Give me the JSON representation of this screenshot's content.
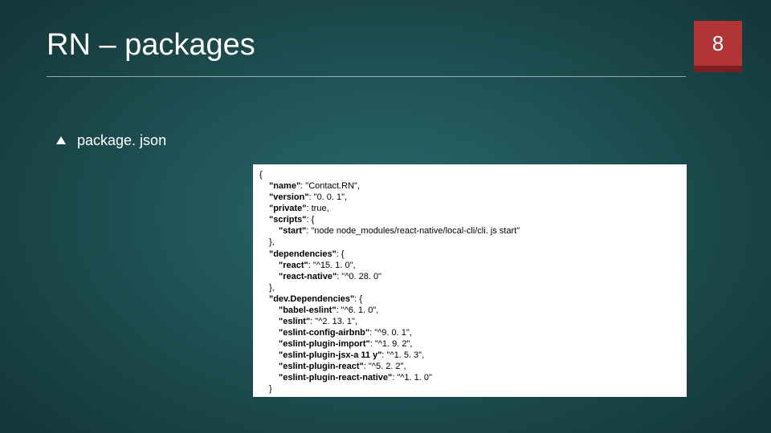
{
  "slide": {
    "title": "RN – packages",
    "page_number": "8",
    "bullet": "package. json"
  },
  "code": {
    "open": "{",
    "name_key": "\"name\"",
    "name_val": ": \"Contact.RN\",",
    "version_key": "\"version\"",
    "version_val": ": \"0. 0. 1\",",
    "private_key": "\"private\"",
    "private_val": ": true,",
    "scripts_key": "\"scripts\"",
    "scripts_open": ": {",
    "start_key": "\"start\"",
    "start_val": ": \"node node_modules/react-native/local-cli/cli. js start\"",
    "close1": "},",
    "deps_key": "\"dependencies\"",
    "deps_open": ": {",
    "react_key": "\"react\"",
    "react_val": ": \"^15. 1. 0\",",
    "rn_key": "\"react-native\"",
    "rn_val": ": \"^0. 28. 0\"",
    "close2": "},",
    "devdeps_key": "\"dev.Dependencies\"",
    "devdeps_open": ": {",
    "babel_key": "\"babel-eslint\"",
    "babel_val": ": \"^6. 1. 0\",",
    "eslint_key": "\"eslint\"",
    "eslint_val": ": \"^2. 13. 1\",",
    "airbnb_key": "\"eslint-config-airbnb\"",
    "airbnb_val": ": \"^9. 0. 1\",",
    "imp_key": "\"eslint-plugin-import\"",
    "imp_val": ": \"^1. 9. 2\",",
    "jsx_key": "\"eslint-plugin-jsx-a 11 y\"",
    "jsx_val": ": \"^1. 5. 3\",",
    "preact_key": "\"eslint-plugin-react\"",
    "preact_val": ": \"^5. 2. 2\",",
    "prn_key": "\"eslint-plugin-react-native\"",
    "prn_val": ": \"^1. 1. 0\"",
    "close3": "}",
    "close4": "}"
  }
}
